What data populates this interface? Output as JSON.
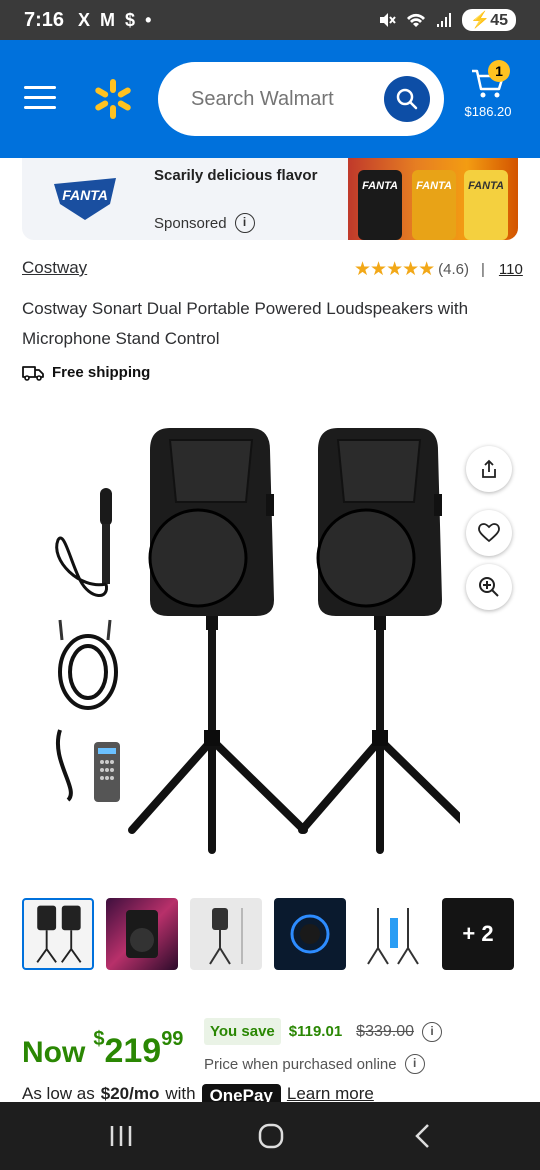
{
  "status_bar": {
    "time": "7:16",
    "left_icons": [
      "X",
      "M",
      "$",
      "•"
    ],
    "battery": "45"
  },
  "header": {
    "search_placeholder": "Search Walmart",
    "cart_count": "1",
    "cart_total": "$186.20",
    "brand_color": "#0071dc",
    "accent_color": "#ffc220"
  },
  "ad": {
    "brand_logo_text": "FANTA",
    "headline": "Scarily delicious flavor",
    "sponsored_label": "Sponsored",
    "info_icon": "i",
    "can_labels": [
      "FANTA",
      "FANTA",
      "FANTA"
    ]
  },
  "product": {
    "brand": "Costway",
    "rating_stars": "★★★★★",
    "rating_value": "(4.6)",
    "separator": "|",
    "review_count": "110",
    "title": "Costway Sonart Dual Portable Powered Loudspeakers with Microphone Stand Control",
    "shipping": "Free shipping"
  },
  "gallery": {
    "more_count": "+ 2",
    "thumbnail_count": 6
  },
  "price": {
    "now_label": "Now",
    "currency": "$",
    "dollars": "219",
    "cents": "99",
    "you_save_label": "You save",
    "save_amount": "$119.01",
    "was_price": "$339.00",
    "online_note": "Price when purchased online",
    "affirm_prefix": "As low as",
    "affirm_amount": "$20/mo",
    "affirm_with": "with",
    "affirm_brand": "OnePay",
    "affirm_link": "Learn more"
  },
  "icons": {
    "menu": "hamburger-menu-icon",
    "logo": "walmart-spark-logo",
    "search": "search-icon",
    "cart": "cart-icon",
    "share": "share-icon",
    "favorite": "heart-icon",
    "zoom": "zoom-in-icon",
    "shipping": "delivery-truck-icon"
  },
  "system_nav": {
    "recents": "recents-icon",
    "home": "home-icon",
    "back": "back-icon"
  }
}
